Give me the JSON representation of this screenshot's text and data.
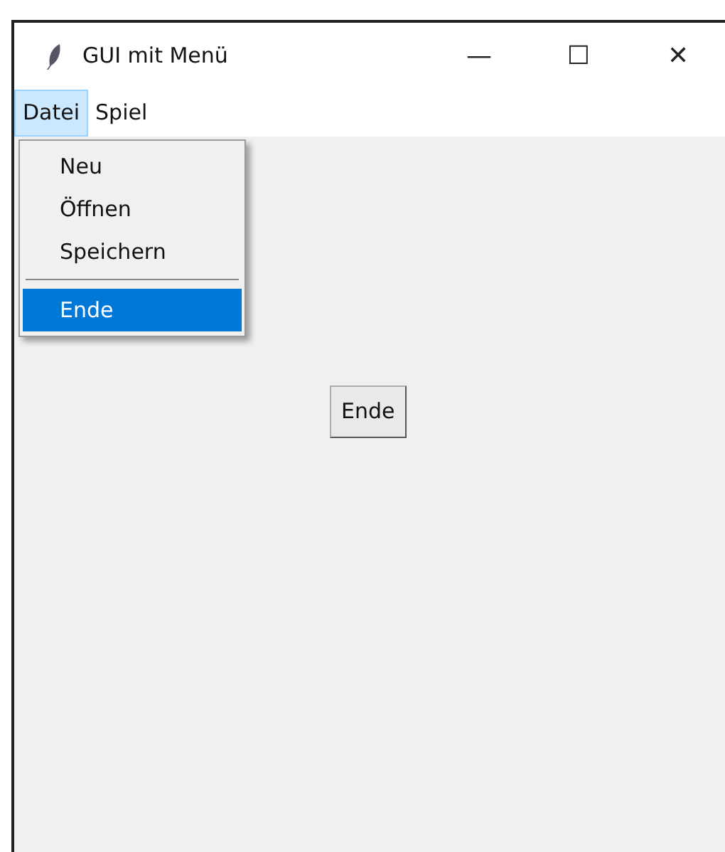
{
  "window": {
    "title": "GUI mit Menü",
    "controls": [
      "—",
      "☐",
      "✕"
    ]
  },
  "menubar": [
    {
      "label": "Datei",
      "selected": true
    },
    {
      "label": "Spiel",
      "selected": false
    }
  ],
  "dropdown": [
    {
      "kind": "item",
      "label": "Neu",
      "selected": false
    },
    {
      "kind": "item",
      "label": "Öffnen",
      "selected": false
    },
    {
      "kind": "item",
      "label": "Speichern",
      "selected": false
    },
    {
      "kind": "separator"
    },
    {
      "kind": "item",
      "label": "Ende",
      "selected": true
    }
  ],
  "content": {
    "button": "Ende"
  }
}
